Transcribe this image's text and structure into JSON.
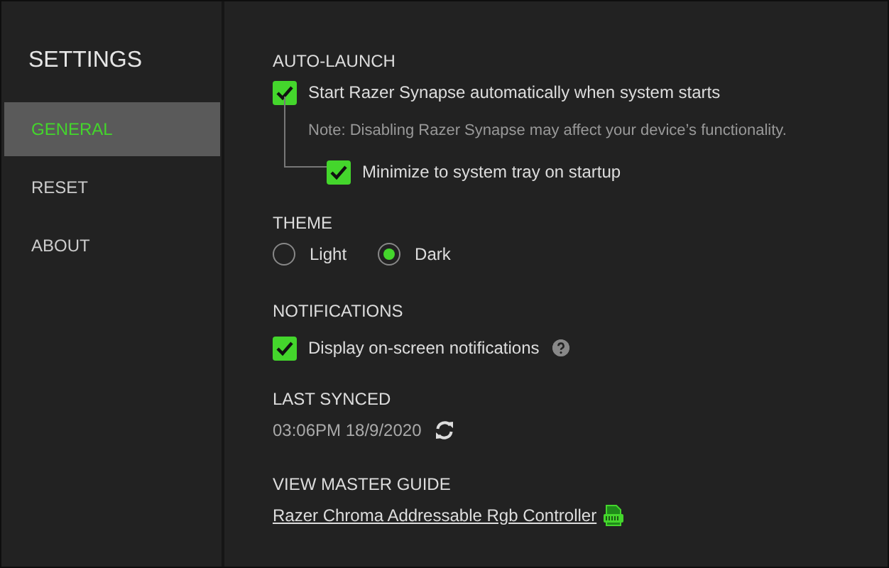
{
  "sidebar": {
    "title": "SETTINGS",
    "items": [
      {
        "label": "GENERAL",
        "selected": true
      },
      {
        "label": "RESET",
        "selected": false
      },
      {
        "label": "ABOUT",
        "selected": false
      }
    ]
  },
  "auto_launch": {
    "heading": "AUTO-LAUNCH",
    "option": {
      "label": "Start Razer Synapse automatically when system starts",
      "checked": true
    },
    "note": "Note: Disabling Razer Synapse may affect your device’s functionality.",
    "sub_option": {
      "label": "Minimize to system tray on startup",
      "checked": true
    }
  },
  "theme": {
    "heading": "THEME",
    "options": [
      {
        "label": "Light",
        "selected": false
      },
      {
        "label": "Dark",
        "selected": true
      }
    ]
  },
  "notifications": {
    "heading": "NOTIFICATIONS",
    "option": {
      "label": "Display on-screen notifications",
      "checked": true
    }
  },
  "last_synced": {
    "heading": "LAST SYNCED",
    "value": "03:06PM 18/9/2020"
  },
  "master_guide": {
    "heading": "VIEW MASTER GUIDE",
    "link": "Razer Chroma Addressable Rgb Controller"
  }
}
